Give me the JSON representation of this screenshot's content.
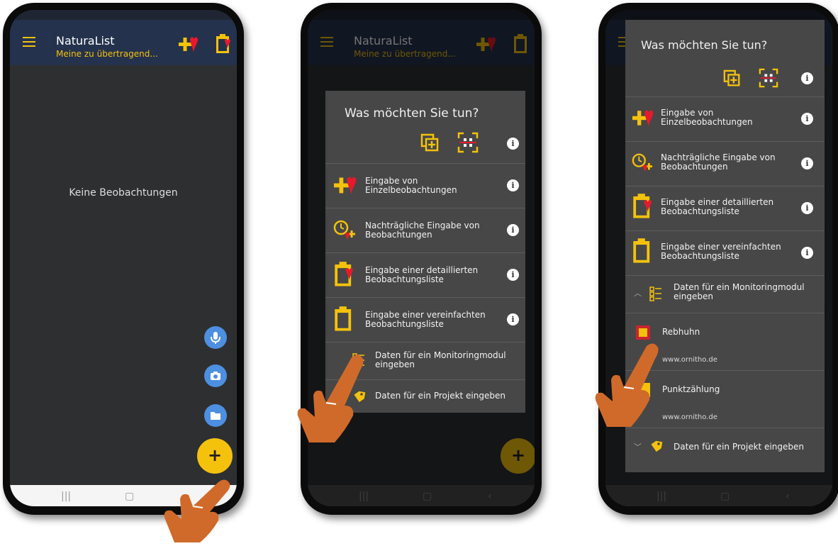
{
  "colors": {
    "accent": "#f4c20d",
    "appbar": "#24324d",
    "background": "#2e2f31",
    "dialog": "#474747",
    "heart": "#e8192c",
    "fab_blue": "#4d8fe0",
    "hand": "#d06a2a"
  },
  "app": {
    "title": "NaturaList",
    "subtitle": "Meine zu übertragend...",
    "empty_text": "Keine Beobachtungen",
    "fab_plus": "+"
  },
  "dialog": {
    "title": "Was möchten Sie tun?",
    "info_glyph": "i",
    "items": [
      {
        "label_1": "Eingabe von",
        "label_2": "Einzelbeobachtungen",
        "icon": "plus-heart-icon"
      },
      {
        "label_1": "Nachträgliche Eingabe von",
        "label_2": "Beobachtungen",
        "icon": "clock-plus-icon"
      },
      {
        "label_1": "Eingabe einer detaillierten",
        "label_2": "Beobachtungsliste",
        "icon": "clipboard-heart-icon"
      },
      {
        "label_1": "Eingabe einer vereinfachten",
        "label_2": "Beobachtungsliste",
        "icon": "clipboard-icon"
      }
    ],
    "monitoring": {
      "label_1": "Daten für ein Monitoringmodul",
      "label_2": "eingeben",
      "icon": "monitoring-list-icon"
    },
    "project": {
      "label": "Daten für ein Projekt eingeben",
      "icon": "tag-icon"
    },
    "submodules": [
      {
        "name": "Rebhuhn",
        "url": "www.ornitho.de"
      },
      {
        "name": "Punktzählung",
        "url": "www.ornitho.de"
      }
    ]
  }
}
